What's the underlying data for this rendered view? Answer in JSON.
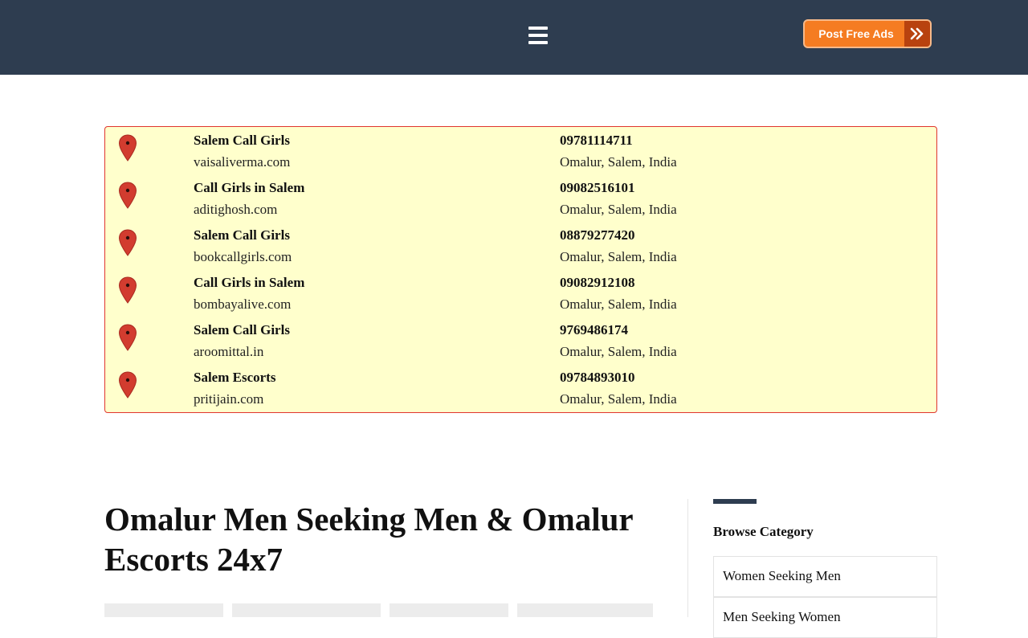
{
  "header": {
    "menu_icon": "hamburger-menu-icon",
    "post_button": {
      "label": "Post Free Ads",
      "icon": "double-chevron-right-icon",
      "color": "#f57c22",
      "arrow_color": "#b8420f"
    },
    "bar_color": "#2e3d50"
  },
  "listings": [
    {
      "title": "Salem Call Girls",
      "site": "vaisaliverma.com",
      "phone": "09781114711",
      "location": "Omalur, Salem, India"
    },
    {
      "title": "Call Girls in Salem",
      "site": "aditighosh.com",
      "phone": "09082516101",
      "location": "Omalur, Salem, India"
    },
    {
      "title": "Salem Call Girls",
      "site": "bookcallgirls.com",
      "phone": "08879277420",
      "location": "Omalur, Salem, India"
    },
    {
      "title": "Call Girls in Salem",
      "site": "bombayalive.com",
      "phone": "09082912108",
      "location": "Omalur, Salem, India"
    },
    {
      "title": "Salem Call Girls",
      "site": "aroomittal.in",
      "phone": "9769486174",
      "location": "Omalur, Salem, India"
    },
    {
      "title": "Salem Escorts",
      "site": "pritijain.com",
      "phone": "09784893010",
      "location": "Omalur, Salem, India"
    }
  ],
  "listing_icon": "map-pin-icon",
  "main": {
    "title": "Omalur Men Seeking Men & Omalur Escorts 24x7"
  },
  "sidebar": {
    "heading": "Browse Category",
    "categories": [
      "Women Seeking Men",
      "Men Seeking Women"
    ]
  }
}
